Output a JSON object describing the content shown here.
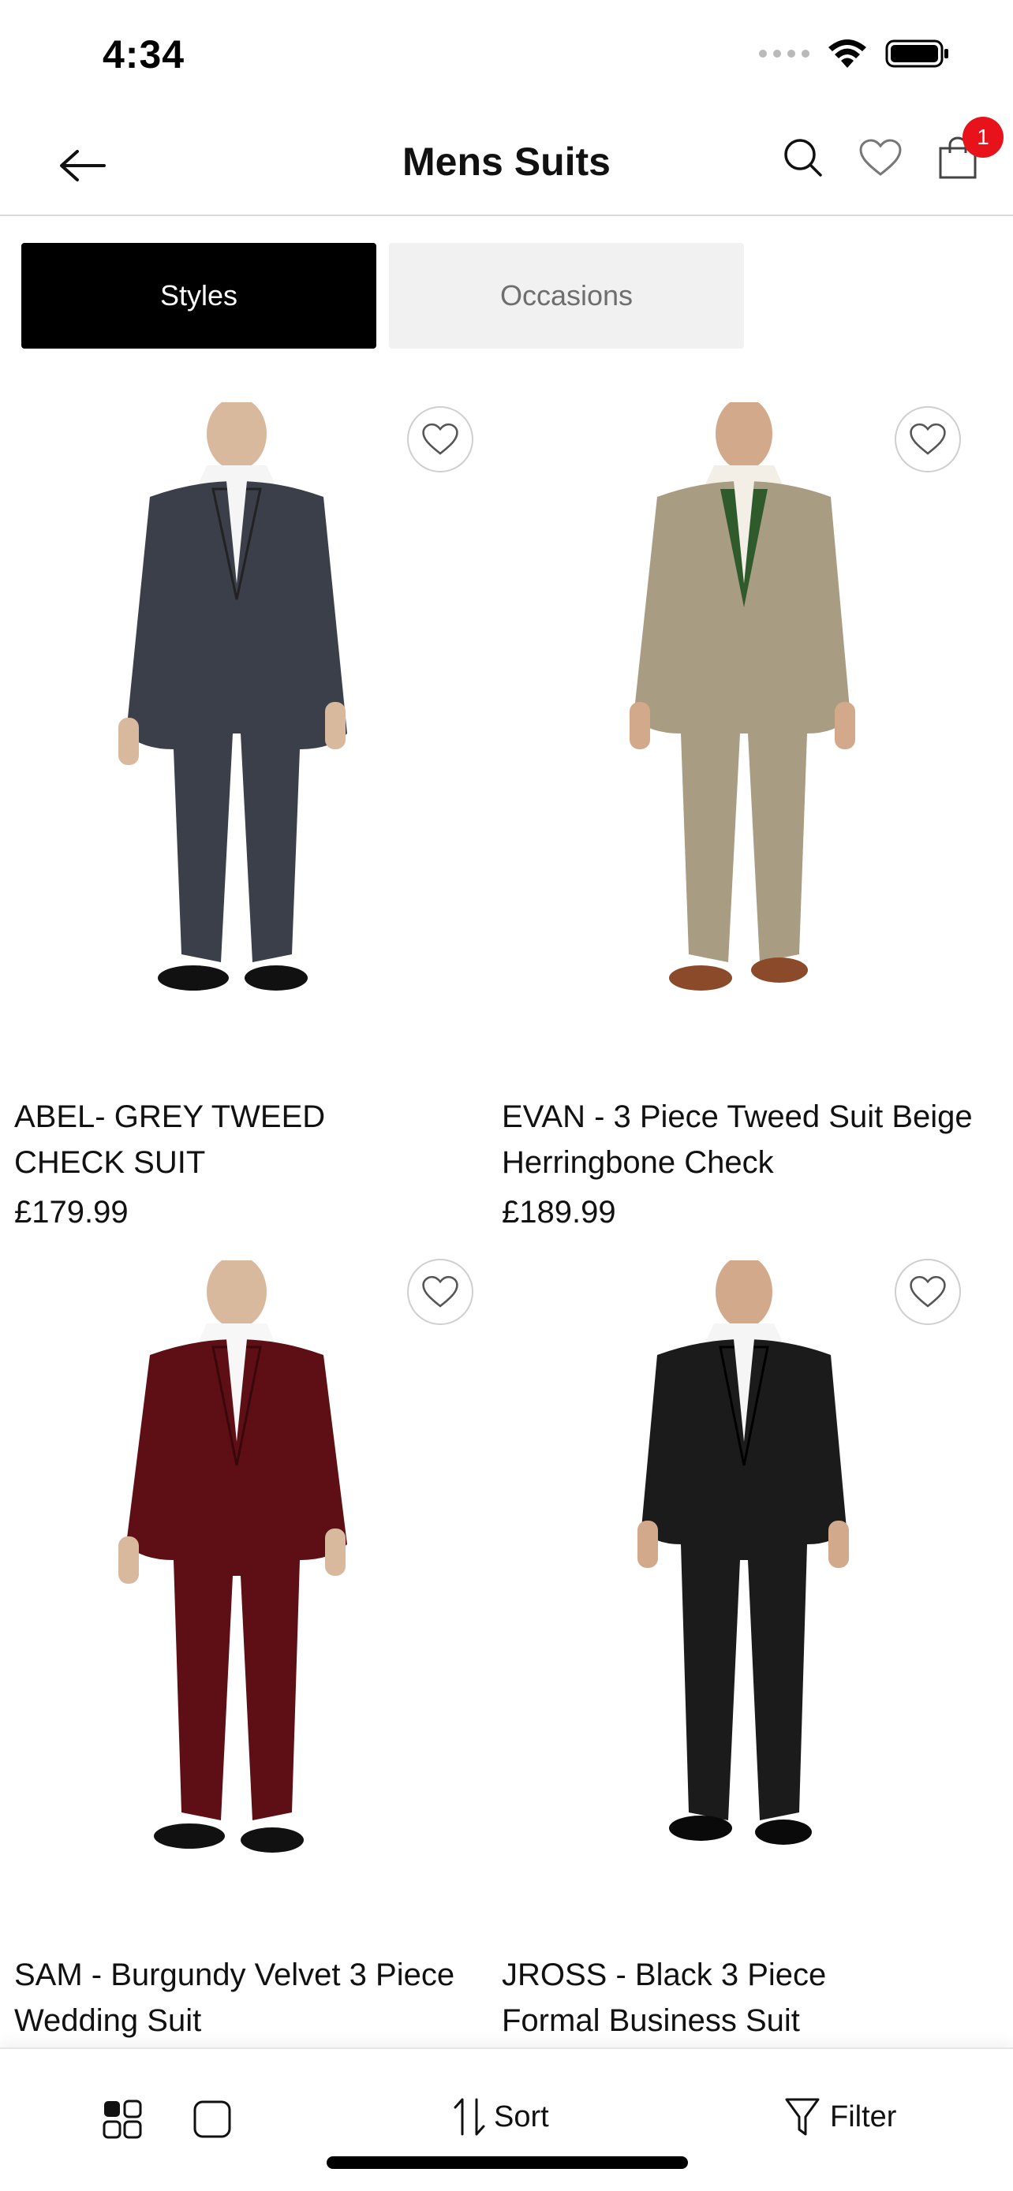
{
  "status": {
    "time": "4:34"
  },
  "header": {
    "title": "Mens Suits",
    "cart_count": "1"
  },
  "tabs": [
    {
      "label": "Styles",
      "active": true
    },
    {
      "label": "Occasions",
      "active": false
    }
  ],
  "products": [
    {
      "name": "ABEL- GREY TWEED CHECK SUIT",
      "price": "£179.99",
      "suit_color": "#3b3f4a",
      "vest_color": "#3b3f4a"
    },
    {
      "name": "EVAN - 3 Piece Tweed Suit Beige Herringbone Check",
      "price": "£189.99",
      "suit_color": "#a89c82",
      "vest_color": "#2f5a2c"
    },
    {
      "name": "SAM - Burgundy Velvet 3 Piece Wedding Suit",
      "price": "",
      "suit_color": "#5e0f16",
      "vest_color": "#5e0f16"
    },
    {
      "name": "JROSS - Black 3 Piece Formal Business Suit",
      "price": "",
      "suit_color": "#1b1b1b",
      "vest_color": "#1b1b1b"
    }
  ],
  "bottom_bar": {
    "sort_label": "Sort",
    "filter_label": "Filter"
  },
  "colors": {
    "accent": "#000000",
    "badge": "#e8121b",
    "tab_inactive_bg": "#f1f1f1"
  }
}
